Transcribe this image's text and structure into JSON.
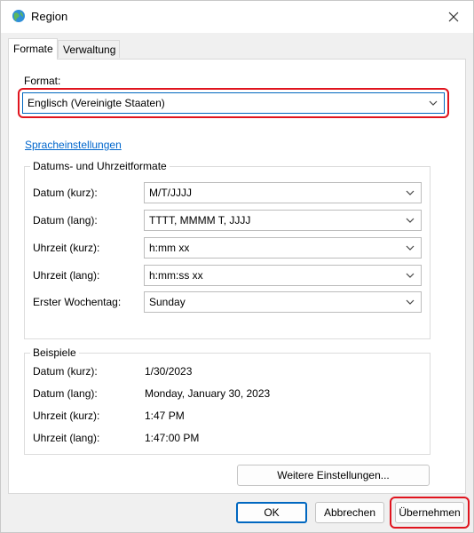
{
  "window": {
    "title": "Region",
    "icon": "globe-icon",
    "close_icon": "close-icon"
  },
  "tabs": [
    {
      "label": "Formate",
      "active": true
    },
    {
      "label": "Verwaltung",
      "active": false
    }
  ],
  "format": {
    "label": "Format:",
    "value": "Englisch (Vereinigte Staaten)"
  },
  "language_link": "Spracheinstellungen",
  "datetime_group": {
    "title": "Datums- und Uhrzeitformate",
    "rows": [
      {
        "label": "Datum (kurz):",
        "value": "M/T/JJJJ"
      },
      {
        "label": "Datum (lang):",
        "value": "TTTT, MMMM T, JJJJ"
      },
      {
        "label": "Uhrzeit (kurz):",
        "value": "h:mm xx"
      },
      {
        "label": "Uhrzeit (lang):",
        "value": "h:mm:ss xx"
      },
      {
        "label": "Erster Wochentag:",
        "value": "Sunday"
      }
    ]
  },
  "examples_group": {
    "title": "Beispiele",
    "rows": [
      {
        "label": "Datum (kurz):",
        "value": "1/30/2023"
      },
      {
        "label": "Datum (lang):",
        "value": "Monday, January 30, 2023"
      },
      {
        "label": "Uhrzeit (kurz):",
        "value": "1:47 PM"
      },
      {
        "label": "Uhrzeit (lang):",
        "value": "1:47:00 PM"
      }
    ]
  },
  "buttons": {
    "more_settings": "Weitere Einstellungen...",
    "ok": "OK",
    "cancel": "Abbrechen",
    "apply": "Übernehmen"
  },
  "colors": {
    "highlight": "#e0141e",
    "link": "#0066cc",
    "accent": "#0067c0"
  }
}
